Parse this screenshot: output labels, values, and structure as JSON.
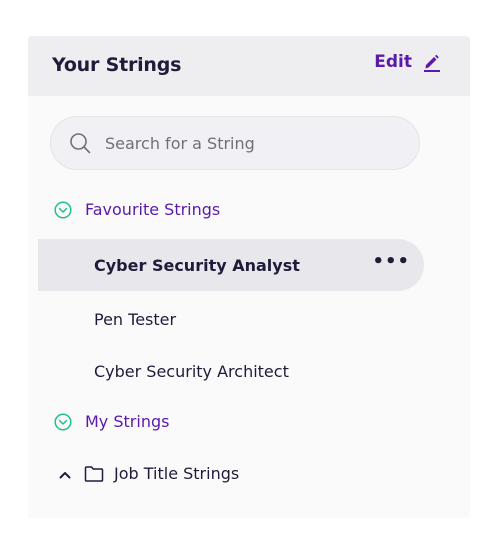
{
  "panel": {
    "title": "Your Strings",
    "edit_label": "Edit",
    "edit_icon": "pencil-icon"
  },
  "search": {
    "placeholder": "Search for a String",
    "icon": "search-icon"
  },
  "favourites": {
    "label": "Favourite Strings",
    "icon": "circle-chevron-down-icon",
    "items": [
      {
        "label": "Cyber Security Analyst",
        "active": true,
        "menu": "•••"
      },
      {
        "label": "Pen Tester"
      },
      {
        "label": "Cyber Security Architect"
      }
    ]
  },
  "my_strings": {
    "label": "My Strings",
    "icon": "circle-chevron-down-icon",
    "folders": [
      {
        "label": "Job Title Strings",
        "expanded": true,
        "icon": "folder-icon"
      }
    ]
  },
  "colors": {
    "accent": "#5b1aa8",
    "section_icon": "#1fbf8f",
    "text": "#1e1c3a",
    "header_bg": "#eeeef1",
    "active_row_bg": "#e8e8ec"
  }
}
